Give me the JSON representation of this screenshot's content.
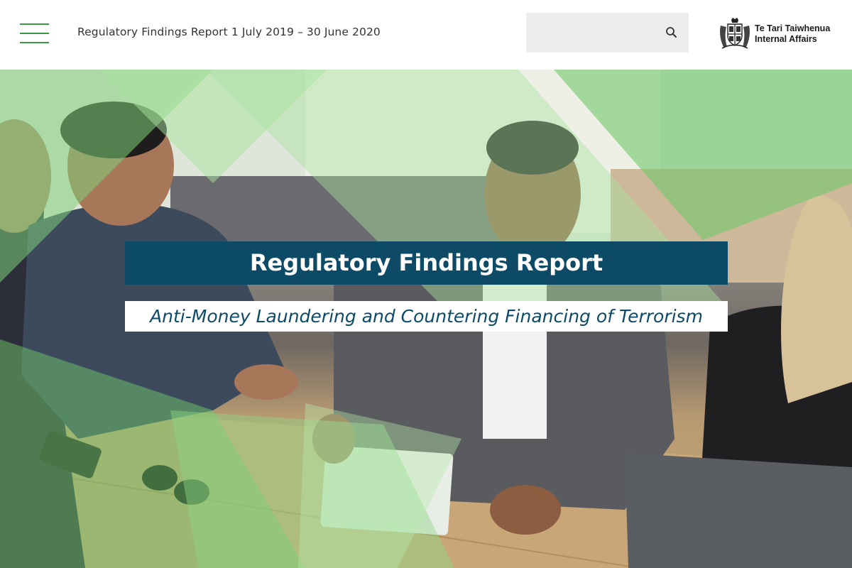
{
  "header": {
    "title": "Regulatory Findings Report 1 July 2019 – 30 June 2020",
    "search": {
      "placeholder": "",
      "value": ""
    },
    "logo": {
      "line1": "Te Tari Taiwhenua",
      "line2": "Internal Affairs"
    }
  },
  "hero": {
    "title": "Regulatory Findings Report",
    "subtitle": "Anti-Money Laundering and Countering Financing of Terrorism"
  },
  "icons": {
    "menu": "hamburger-menu-icon",
    "search": "search-icon",
    "crest": "coat-of-arms-icon"
  },
  "colors": {
    "accent_green": "#3a9a44",
    "banner_navy": "#0d4a66",
    "overlay_green": "#7fd07a"
  }
}
